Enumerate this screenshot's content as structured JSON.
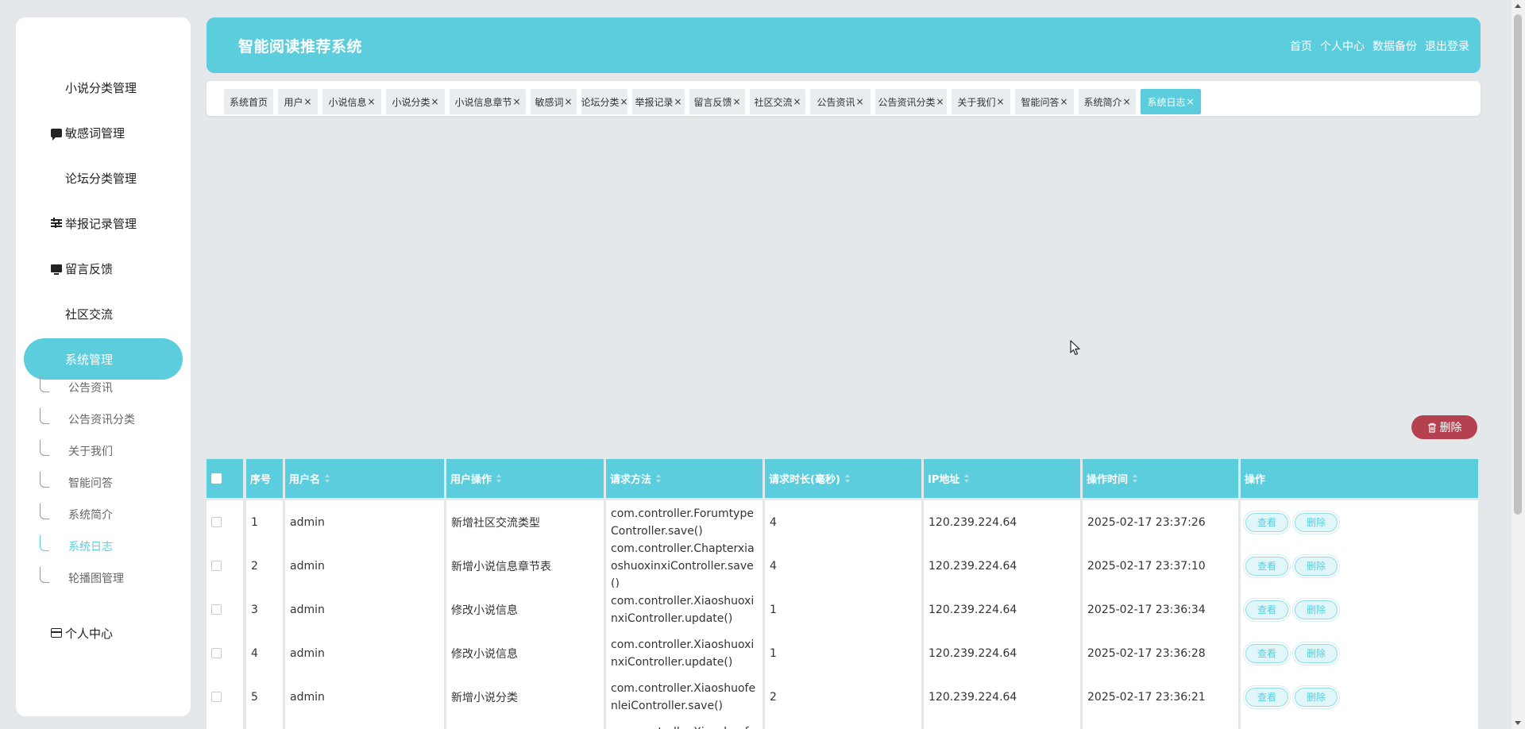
{
  "app": {
    "title": "智能阅读推荐系统"
  },
  "header_nav": [
    "首页",
    "个人中心",
    "数据备份",
    "退出登录"
  ],
  "sidebar": {
    "items": [
      {
        "label": "小说分类管理",
        "icon": "grid-icon"
      },
      {
        "label": "敏感词管理",
        "icon": "chat-icon"
      },
      {
        "label": "论坛分类管理",
        "icon": "grid-icon"
      },
      {
        "label": "举报记录管理",
        "icon": "sliders-icon"
      },
      {
        "label": "留言反馈",
        "icon": "monitor-icon"
      },
      {
        "label": "社区交流",
        "icon": "grid-icon"
      },
      {
        "label": "系统管理",
        "icon": "grid-icon",
        "active": true
      },
      {
        "label": "个人中心",
        "icon": "card-icon"
      }
    ],
    "sub_items": [
      {
        "label": "公告资讯"
      },
      {
        "label": "公告资讯分类"
      },
      {
        "label": "关于我们"
      },
      {
        "label": "智能问答"
      },
      {
        "label": "系统简介"
      },
      {
        "label": "系统日志",
        "active": true
      },
      {
        "label": "轮播图管理"
      }
    ]
  },
  "tabs": [
    {
      "label": "系统首页",
      "closable": false
    },
    {
      "label": "用户",
      "closable": true
    },
    {
      "label": "小说信息",
      "closable": true
    },
    {
      "label": "小说分类",
      "closable": true
    },
    {
      "label": "小说信息章节",
      "closable": true
    },
    {
      "label": "敏感词",
      "closable": true
    },
    {
      "label": "论坛分类",
      "closable": true
    },
    {
      "label": "举报记录",
      "closable": true
    },
    {
      "label": "留言反馈",
      "closable": true
    },
    {
      "label": "社区交流",
      "closable": true
    },
    {
      "label": "公告资讯",
      "closable": true
    },
    {
      "label": "公告资讯分类",
      "closable": true
    },
    {
      "label": "关于我们",
      "closable": true
    },
    {
      "label": "智能问答",
      "closable": true
    },
    {
      "label": "系统简介",
      "closable": true
    },
    {
      "label": "系统日志",
      "closable": true,
      "active": true
    }
  ],
  "tab_close_glyph": "×",
  "toolbar": {
    "delete_label": "删除"
  },
  "table": {
    "columns": [
      "序号",
      "用户名",
      "用户操作",
      "请求方法",
      "请求时长(毫秒)",
      "IP地址",
      "操作时间",
      "操作"
    ],
    "sortable": [
      false,
      true,
      true,
      true,
      true,
      true,
      true,
      false
    ],
    "rows": [
      {
        "index": "1",
        "username": "admin",
        "operation": "新增社区交流类型",
        "method": "com.controller.ForumtypeController.save()",
        "duration": "4",
        "ip": "120.239.224.64",
        "time": "2025-02-17 23:37:26"
      },
      {
        "index": "2",
        "username": "admin",
        "operation": "新增小说信息章节表",
        "method": "com.controller.ChapterxiaoshuoxinxiController.save()",
        "duration": "4",
        "ip": "120.239.224.64",
        "time": "2025-02-17 23:37:10"
      },
      {
        "index": "3",
        "username": "admin",
        "operation": "修改小说信息",
        "method": "com.controller.XiaoshuoxinxiController.update()",
        "duration": "1",
        "ip": "120.239.224.64",
        "time": "2025-02-17 23:36:34"
      },
      {
        "index": "4",
        "username": "admin",
        "operation": "修改小说信息",
        "method": "com.controller.XiaoshuoxinxiController.update()",
        "duration": "1",
        "ip": "120.239.224.64",
        "time": "2025-02-17 23:36:28"
      },
      {
        "index": "5",
        "username": "admin",
        "operation": "新增小说分类",
        "method": "com.controller.XiaoshuofenleiController.save()",
        "duration": "2",
        "ip": "120.239.224.64",
        "time": "2025-02-17 23:36:21"
      },
      {
        "index": "",
        "username": "",
        "operation": "",
        "method": "com.controller.Xiaoshuofenl",
        "duration": "",
        "ip": "",
        "time": ""
      }
    ],
    "row_actions": {
      "view": "查看",
      "delete": "删除"
    }
  },
  "colors": {
    "accent": "#5bcddc",
    "danger": "#b5404f",
    "background": "#e4e8ea"
  }
}
